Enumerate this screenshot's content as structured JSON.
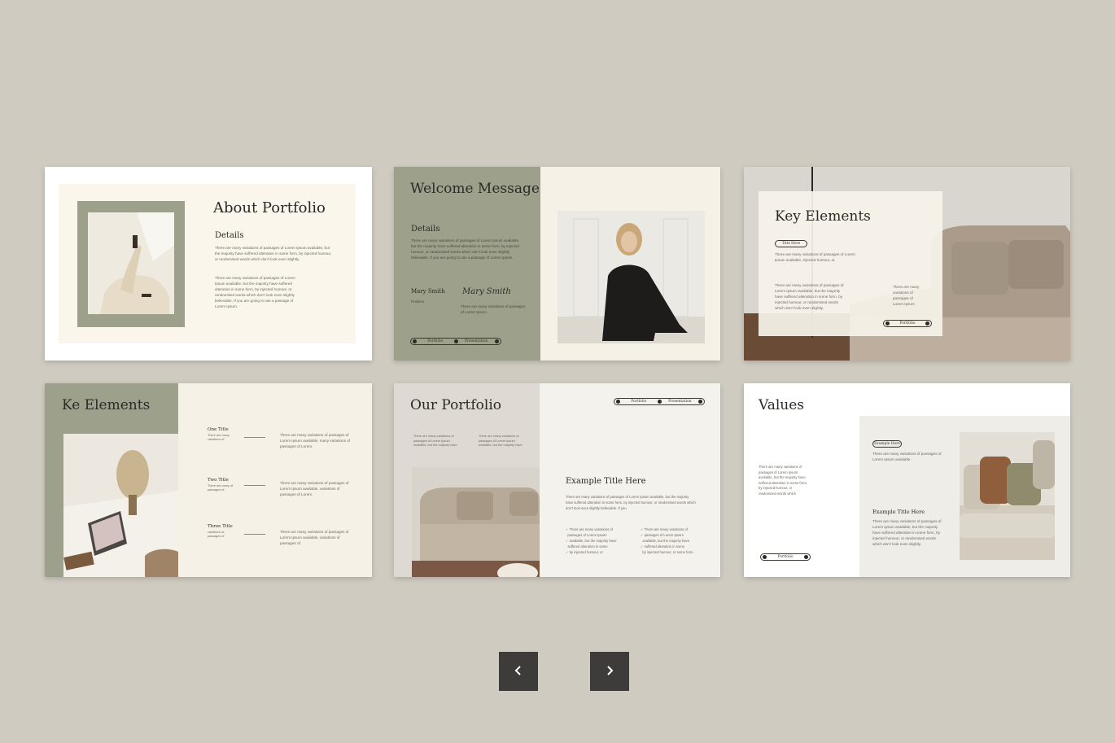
{
  "slides": {
    "about": {
      "title": "About Portfolio",
      "subtitle": "Details",
      "body": "There are many variations of passages of Lorem Ipsum available, but the majority have suffered alteration in some form, by injected humour, or randomised words which don't look even slightly.",
      "bullets": [
        "There are many variations of passages of Lorem",
        "Ipsum available, but the majority have suffered",
        "alteration in some form, by injected humour, or",
        "randomised words which don't look even slightly",
        "believable. If you are going to use a passage of",
        "Lorem Ipsum."
      ]
    },
    "welcome": {
      "title": "Welcome Message",
      "subtitle": "Details",
      "body": "There are many variations of passages of Lorem Ipsum available, but the majority have suffered alteration in some form, by injected humour, or randomised words which don't look even slightly believable. If you are going to use a passage of Lorem Ipsum.",
      "name": "Mary Smith",
      "position": "Position",
      "signature": "Mary Smith",
      "sig_note": "There are many variations of passages of Lorem Ipsum",
      "pill_left": "Portfolio",
      "pill_right": "Presentation"
    },
    "key": {
      "title": "Key Elements",
      "tag": "Title Here",
      "body1": "There are many variations of passages of Lorem Ipsum available, injected humour, or.",
      "body2": "There are many variations of passages of Lorem Ipsum available, but the majority have suffered alteration in some form, by injected humour, or randomised words which don't look even slightly.",
      "side": "There are many variations of passages of Lorem Ipsum",
      "pill": "Portfolio"
    },
    "ke": {
      "title": "Ke Elements",
      "rows": [
        {
          "title": "One Title",
          "sub": "There are many variations of",
          "text": "There are many variations of passages of Lorem Ipsum available, many variations of passages of Lorem."
        },
        {
          "title": "Two Title",
          "sub": "There are many of passages of",
          "text": "There are many variations of passages of Lorem Ipsum available, variations of passages of Lorem."
        },
        {
          "title": "Three Title",
          "sub": "variations of passages of",
          "text": "There are many variations of passages of Lorem Ipsum available, variations of passages of."
        }
      ]
    },
    "our": {
      "title": "Our Portfolio",
      "col1": "There are many variations of passages of Lorem Ipsum available, but the majority have",
      "col2": "There are many variations of passages of Lorem Ipsum available, but the majority have",
      "pill_left": "Portfolio",
      "pill_right": "Presentation",
      "example_title": "Example Title Here",
      "body": "There are many variations of passages of Lorem Ipsum available, but the majority have suffered alteration in some form, by injected humour, or randomised words which don't look even slightly believable. If you",
      "checks_left": [
        "There are many variations of",
        "passages of Lorem Ipsum",
        "available, but the majority have",
        "suffered alteration in some",
        "by injected humour, or"
      ],
      "checks_right": [
        "There are many variations of",
        "passages of Lorem Ipsum",
        "available, but the majority have",
        "suffered alteration in some",
        "by injected humour, or some form."
      ]
    },
    "values": {
      "title": "Values",
      "body": "There are many variations of passages of Lorem Ipsum available, but the majority have suffered alteration in some form, by injected humour, or randomised words which",
      "pill": "Portfolio",
      "tag": "Example Here",
      "tag_text": "There are many variations of passages of Lorem Ipsum available.",
      "example_title": "Example Title Here",
      "example_body": "There are many variations of passages of Lorem Ipsum available, but the majority have suffered alteration in some form, by injected humour, or randomised words which don't look even slightly."
    }
  },
  "nav": {
    "prev_icon": "chevron-left-icon",
    "next_icon": "chevron-right-icon"
  },
  "colors": {
    "background": "#cfcbc1",
    "sage": "#9da18b",
    "cream": "#f6f1e6",
    "button": "#3d3c3a"
  }
}
